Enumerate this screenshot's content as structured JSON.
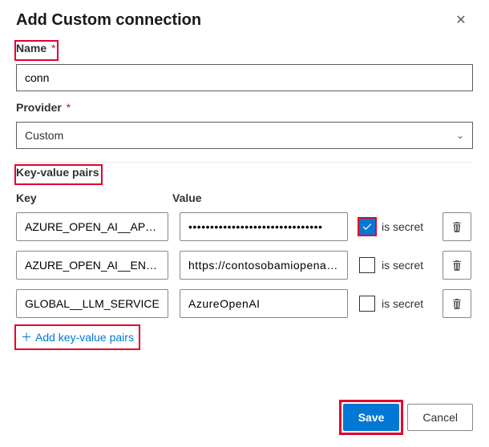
{
  "dialog": {
    "title": "Add Custom connection"
  },
  "fields": {
    "name_label": "Name",
    "name_value": "conn",
    "provider_label": "Provider",
    "provider_value": "Custom",
    "required_marker": "*"
  },
  "kv": {
    "section_label": "Key-value pairs",
    "key_header": "Key",
    "value_header": "Value",
    "secret_label": "is secret",
    "rows": [
      {
        "key": "AZURE_OPEN_AI__API_KEY",
        "value": "•••••••••••••••••••••••••••••••",
        "is_secret": true
      },
      {
        "key": "AZURE_OPEN_AI__ENDPOINT",
        "value": "https://contosobamiopenai.ope",
        "is_secret": false
      },
      {
        "key": "GLOBAL__LLM_SERVICE",
        "value": "AzureOpenAI",
        "is_secret": false
      }
    ],
    "add_label": "Add key-value pairs"
  },
  "buttons": {
    "save": "Save",
    "cancel": "Cancel"
  }
}
